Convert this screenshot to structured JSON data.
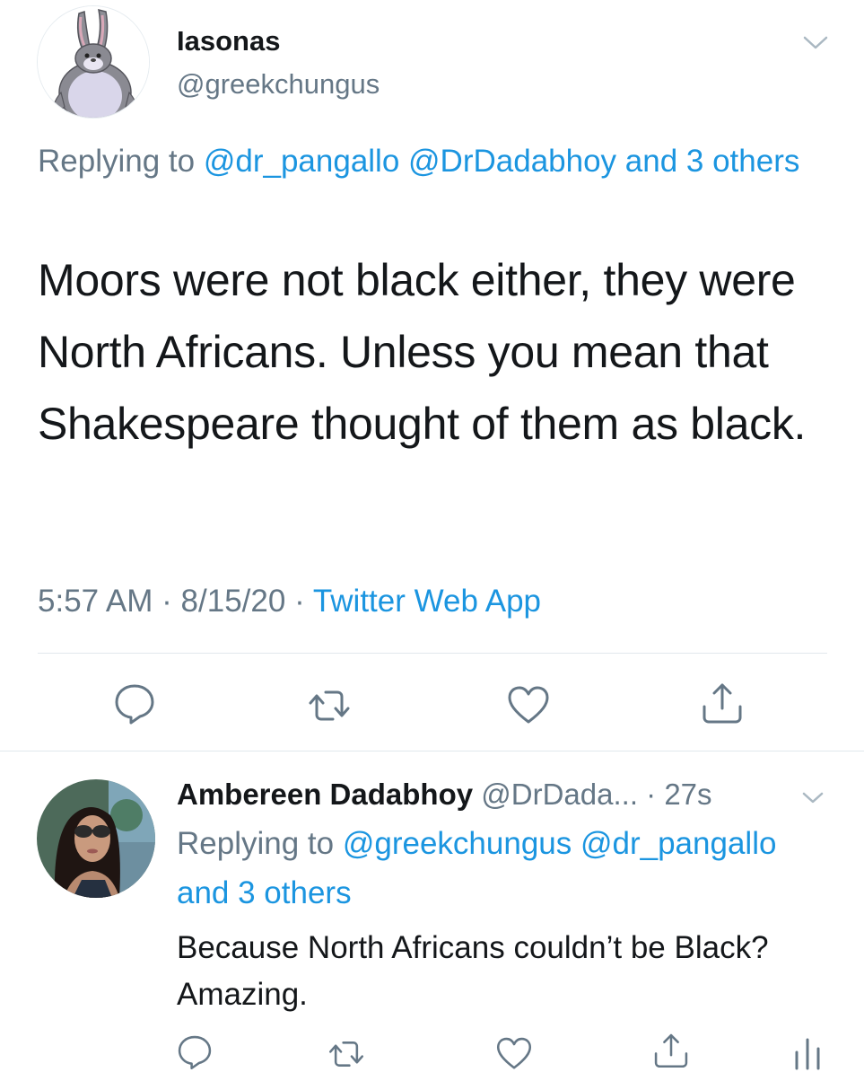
{
  "main_tweet": {
    "display_name": "Iasonas",
    "handle": "@greekchungus",
    "replying_prefix": "Replying to",
    "replying_mentions": "@dr_pangallo @DrDadabhoy and 3 others",
    "text": "Moors were not black either, they were North Africans. Unless you mean that Shakespeare thought of them as black.",
    "time": "5:57 AM",
    "sep1": "·",
    "date": "8/15/20",
    "sep2": "·",
    "source": "Twitter Web App",
    "avatar_icon": "bunny-avatar-icon"
  },
  "reply_tweet": {
    "display_name": "Ambereen Dadabhoy",
    "handle": "@DrDada...",
    "sep": "·",
    "time_ago": "27s",
    "replying_prefix": "Replying to",
    "replying_mentions": "@greekchungus @dr_pangallo and 3 others",
    "text": "Because North Africans couldn’t be Black? Amazing.",
    "avatar_icon": "profile-photo-avatar"
  },
  "icons": {
    "reply": "reply-icon",
    "retweet": "retweet-icon",
    "like": "heart-icon",
    "share": "share-icon",
    "analytics": "analytics-icon",
    "menu": "chevron-down-icon"
  },
  "colors": {
    "text": "#14171a",
    "secondary": "#657786",
    "link": "#1b95e0",
    "divider": "#e1e8ed"
  }
}
